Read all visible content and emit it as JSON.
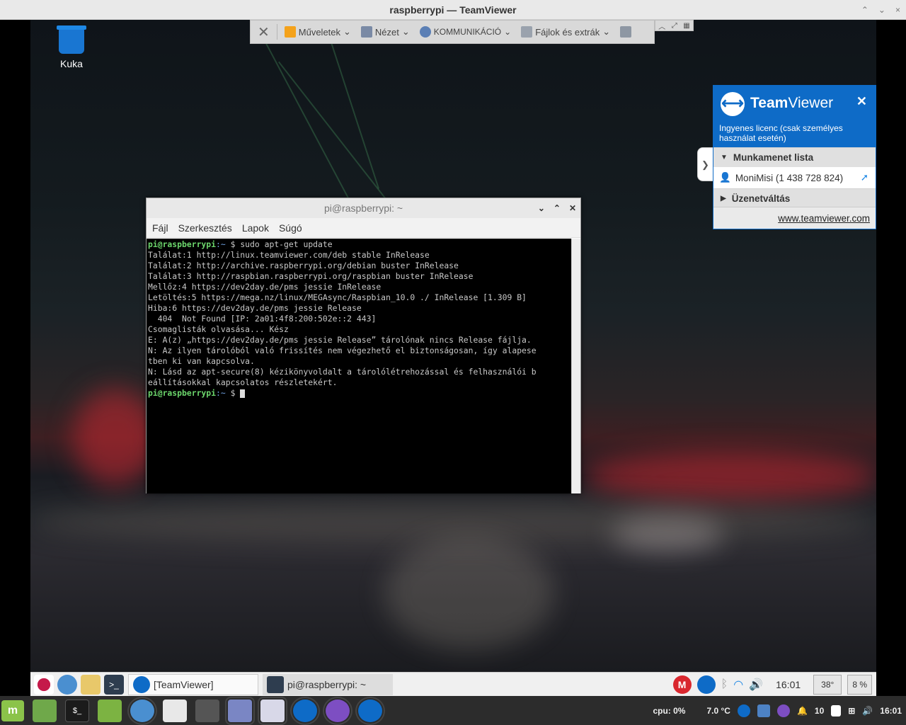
{
  "window_title": "raspberrypi — TeamViewer",
  "outer_controls": [
    "⌃",
    "⌄",
    "×"
  ],
  "toolbar": {
    "actions": "Műveletek",
    "view": "Nézet",
    "communication": "KOMMUNIKÁCIÓ",
    "files": "Fájlok és extrák"
  },
  "desktop": {
    "trash_label": "Kuka"
  },
  "terminal": {
    "title": "pi@raspberrypi: ~",
    "menu": [
      "Fájl",
      "Szerkesztés",
      "Lapok",
      "Súgó"
    ],
    "lines": [
      {
        "prompt": "pi@raspberrypi",
        "path": ":~ $ ",
        "text": "sudo apt-get update"
      },
      {
        "text": "Találat:1 http://linux.teamviewer.com/deb stable InRelease"
      },
      {
        "text": "Találat:2 http://archive.raspberrypi.org/debian buster InRelease"
      },
      {
        "text": "Találat:3 http://raspbian.raspberrypi.org/raspbian buster InRelease"
      },
      {
        "text": "Mellőz:4 https://dev2day.de/pms jessie InRelease"
      },
      {
        "text": "Letöltés:5 https://mega.nz/linux/MEGAsync/Raspbian_10.0 ./ InRelease [1.309 B]"
      },
      {
        "text": "Hiba:6 https://dev2day.de/pms jessie Release"
      },
      {
        "text": "  404  Not Found [IP: 2a01:4f8:200:502e::2 443]"
      },
      {
        "text": "Csomaglisták olvasása... Kész"
      },
      {
        "text": "E: A(z) „https://dev2day.de/pms jessie Release” tárolónak nincs Release fájlja."
      },
      {
        "text": "N: Az ilyen tárolóból való frissítés nem végezhető el biztonságosan, így alapese"
      },
      {
        "text": "tben ki van kapcsolva."
      },
      {
        "text": "N: Lásd az apt-secure(8) kézikönyvoldalt a tárolólétrehozással és felhasználói b"
      },
      {
        "text": "eállításokkal kapcsolatos részletekért."
      },
      {
        "prompt": "pi@raspberrypi",
        "path": ":~ $ ",
        "text": ""
      }
    ]
  },
  "teamviewer_panel": {
    "brand_bold": "Team",
    "brand_rest": "Viewer",
    "license": "Ingyenes licenc (csak személyes használat esetén)",
    "session_list": "Munkamenet lista",
    "session_entry": "MoniMisi (1 438 728 824)",
    "chat": "Üzenetváltás",
    "link": "www.teamviewer.com"
  },
  "remote_taskbar": {
    "win1": "[TeamViewer]",
    "win2": "pi@raspberrypi: ~",
    "clock": "16:01",
    "temp": "38°",
    "cpu": "8 %"
  },
  "host_taskbar": {
    "cpu": "cpu: 0%",
    "temp": "7.0 °C",
    "notif_count": "10",
    "clock": "16:01"
  }
}
